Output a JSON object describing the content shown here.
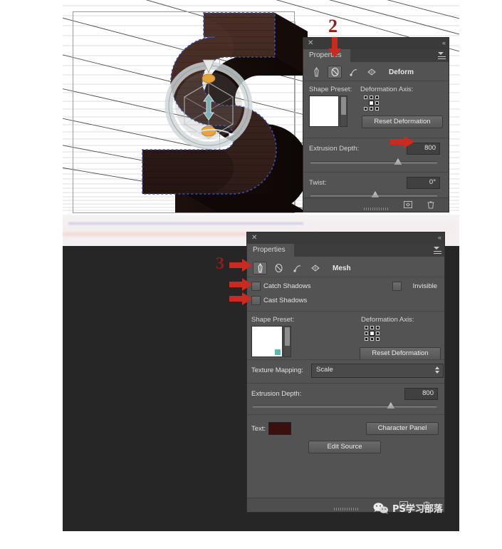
{
  "document": {
    "app": "Adobe Photoshop 3D Properties",
    "tutorial_step_labels": [
      "2",
      "3"
    ]
  },
  "canvas": {
    "object_label": "3D extruded letter S",
    "object_color": "#3b2520",
    "ground_plane": true,
    "grid_visible": true,
    "widget": "3d-axis-move-widget"
  },
  "panel_top": {
    "close_label": "✕",
    "collapse_label": "«",
    "tab_label": "Properties",
    "icon_row": {
      "icons": [
        {
          "name": "mesh-icon",
          "selected": false
        },
        {
          "name": "deform-icon",
          "selected": true
        },
        {
          "name": "cap-icon",
          "selected": false
        },
        {
          "name": "coordinates-icon",
          "selected": false
        }
      ],
      "title": "Deform"
    },
    "shape_preset_label": "Shape Preset:",
    "deformation_axis_label": "Deformation Axis:",
    "reset_deformation_label": "Reset Deformation",
    "extrusion_depth_label": "Extrusion Depth:",
    "extrusion_depth_value": "800",
    "twist_label": "Twist:",
    "twist_value": "0°",
    "footer_icons": [
      "new-3d-object-icon",
      "delete-icon"
    ]
  },
  "panel_bottom": {
    "close_label": "✕",
    "collapse_label": "«",
    "tab_label": "Properties",
    "icon_row": {
      "icons": [
        {
          "name": "mesh-icon",
          "selected": true
        },
        {
          "name": "deform-icon",
          "selected": false
        },
        {
          "name": "cap-icon",
          "selected": false
        },
        {
          "name": "coordinates-icon",
          "selected": false
        }
      ],
      "title": "Mesh"
    },
    "catch_shadows_label": "Catch Shadows",
    "catch_shadows_checked": false,
    "cast_shadows_label": "Cast Shadows",
    "cast_shadows_checked": false,
    "invisible_label": "Invisible",
    "invisible_checked": false,
    "shape_preset_label": "Shape Preset:",
    "deformation_axis_label": "Deformation Axis:",
    "reset_deformation_label": "Reset Deformation",
    "texture_mapping_label": "Texture Mapping:",
    "texture_mapping_value": "Scale",
    "extrusion_depth_label": "Extrusion Depth:",
    "extrusion_depth_value": "800",
    "text_label": "Text:",
    "text_color": "#3a0f0d",
    "character_panel_label": "Character Panel",
    "edit_source_label": "Edit Source",
    "footer_icons": [
      "new-3d-object-icon",
      "delete-icon"
    ]
  },
  "annotations": {
    "step2": "2",
    "step3": "3",
    "arrow_color": "#cc2a20"
  },
  "watermark": {
    "icon": "wechat-icon",
    "text": "PS学习部落"
  },
  "colors": {
    "panel_bg": "#535353",
    "panel_header": "#3a3a3a",
    "workspace_dark": "#262626",
    "accent_red": "#cc2a20"
  }
}
